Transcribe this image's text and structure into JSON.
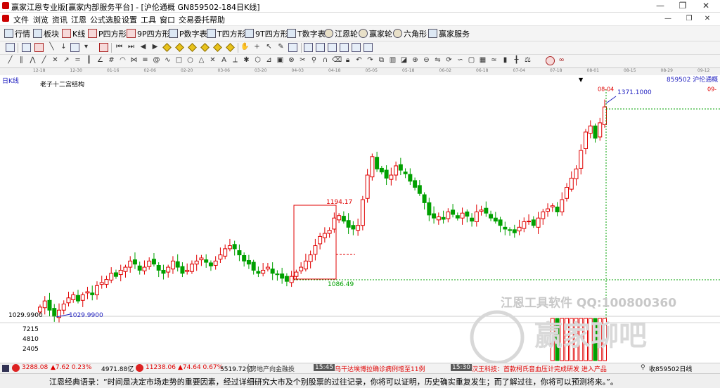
{
  "window": {
    "title": "赢家江恩专业版[赢家内部服务平台] - [沪伦通概  GN859502-184日K线]",
    "controls": [
      "—",
      "❐",
      "✕"
    ],
    "sub_controls": [
      "—",
      "❐",
      "✕"
    ]
  },
  "menu": {
    "items": [
      "文件",
      "浏览",
      "资讯",
      "江恩",
      "公式选股",
      "设置",
      "工具",
      "窗口",
      "交易委托",
      "帮助"
    ]
  },
  "toolbar1": {
    "items": [
      "行情",
      "板块",
      "K线",
      "P四方形",
      "9P四方形",
      "P数字表",
      "T四方形",
      "9T四方形",
      "T数字表",
      "江恩轮",
      "赢家轮",
      "六角形",
      "赢家服务"
    ]
  },
  "date_axis": {
    "ticks": [
      "12-18",
      "12-30",
      "01-16",
      "02-06",
      "02-20",
      "03-06",
      "03-20",
      "04-03",
      "04-18",
      "05-05",
      "05-18",
      "06-02",
      "06-18",
      "07-04",
      "07-18",
      "08-01",
      "08-15",
      "08-29",
      "09-12"
    ]
  },
  "chart_header": {
    "period": "日K线",
    "indicator": "老子十二宫结构",
    "code_name": "859502  沪伦通概",
    "right_date": "09-",
    "current_date": "08-04"
  },
  "annotations": {
    "high_label": "1371.1000",
    "box_top": "1194.17",
    "box_bottom": "1086.49",
    "low_label": "1029.9900",
    "axis_low": "1029.9900"
  },
  "volume_axis": [
    "7215",
    "4810",
    "2405"
  ],
  "watermarks": {
    "software": "江恩工具软件  QQ:100800360",
    "brand": "赢家聊吧"
  },
  "status_bar": {
    "sh_index": "3288.08",
    "sh_change": "▲7.62 0.23%",
    "sh_amount": "4971.88亿",
    "sz_index": "11238.06",
    "sz_change": "▲74.64 0.67%",
    "sz_amount": "5519.72亿",
    "news1": "房地产向金融投",
    "news2_time": "15:45",
    "news2": "乌干达埃博拉确诊病例增至11例",
    "news3_time": "15:30",
    "news3": "汉王科技：首款柯氏音血压计完成研发 进入产品",
    "right_label": "收859502日线"
  },
  "quote_bar": {
    "text": "江恩经典语录：“时间是决定市场走势的重要因素，经过详细研究大市及个别股票的过往记录，你将可以证明，历史确实重复发生；而了解过往，你将可以预测将来。”。"
  },
  "colors": {
    "up": "#e00000",
    "down": "#00a000",
    "box": "#e00000",
    "dashed_green": "#00a000",
    "blue_label": "#2020c0"
  },
  "chart_data": {
    "type": "candlestick",
    "period": "日K线",
    "symbol": "859502",
    "name": "沪伦通概",
    "approx_low": 1029.99,
    "approx_high": 1371.1,
    "box_range": [
      1086.49,
      1194.17
    ],
    "closes": [
      1045,
      1055,
      1040,
      1030,
      1040,
      1050,
      1060,
      1065,
      1055,
      1065,
      1070,
      1065,
      1080,
      1085,
      1090,
      1100,
      1095,
      1105,
      1110,
      1120,
      1115,
      1105,
      1110,
      1120,
      1115,
      1105,
      1100,
      1110,
      1120,
      1110,
      1100,
      1105,
      1115,
      1120,
      1125,
      1118,
      1112,
      1120,
      1130,
      1140,
      1145,
      1140,
      1130,
      1120,
      1115,
      1105,
      1100,
      1105,
      1110,
      1100,
      1098,
      1092,
      1087,
      1095,
      1102,
      1110,
      1120,
      1130,
      1145,
      1160,
      1165,
      1170,
      1190,
      1194,
      1185,
      1175,
      1172,
      1178,
      1220,
      1260,
      1290,
      1270,
      1265,
      1255,
      1260,
      1275,
      1268,
      1262,
      1250,
      1240,
      1230,
      1215,
      1195,
      1190,
      1192,
      1188,
      1200,
      1196,
      1190,
      1198,
      1193,
      1185,
      1200,
      1203,
      1198,
      1190,
      1185,
      1178,
      1172,
      1170,
      1166,
      1175,
      1184,
      1185,
      1178,
      1190,
      1200,
      1205,
      1210,
      1200,
      1220,
      1240,
      1255,
      1270,
      1300,
      1330,
      1340,
      1320,
      1345,
      1371
    ]
  }
}
